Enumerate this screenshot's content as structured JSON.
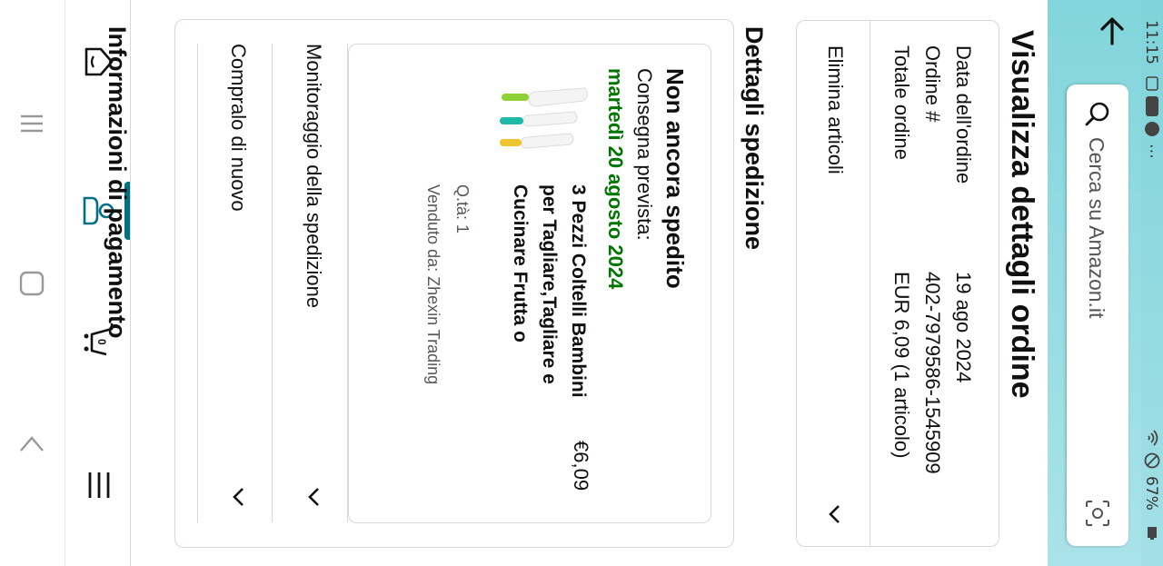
{
  "status_bar": {
    "time": "11:15",
    "battery": "67%"
  },
  "header": {
    "search_placeholder": "Cerca su Amazon.it"
  },
  "page": {
    "title": "Visualizza dettagli ordine"
  },
  "order_info": {
    "rows": [
      {
        "label": "Data dell'ordine",
        "value": "19 ago 2024"
      },
      {
        "label": "Ordine #",
        "value": "402-7979586-1545909"
      },
      {
        "label": "Totale ordine",
        "value": "EUR 6,09 (1 articolo)"
      }
    ],
    "delete_label": "Elimina articoli"
  },
  "shipment": {
    "heading": "Dettagli spedizione",
    "status": "Non ancora spedito",
    "eta_label": "Consegna prevista:",
    "eta_date": "martedì 20 agosto 2024",
    "item": {
      "title": "3 Pezzi Coltelli Bambini per Tagliare,Tagliare e Cucinare Frutta o",
      "price": "€6,09",
      "qty": "Q.tà: 1",
      "seller": "Venduto da: Zhexin Trading"
    },
    "actions": [
      {
        "label": "Monitoraggio della spedizione"
      },
      {
        "label": "Compralo di nuovo"
      }
    ]
  },
  "payment": {
    "heading": "Informazioni di pagamento"
  },
  "colors": {
    "header": "#8fdbe0",
    "accent": "#007185",
    "eta": "#007600"
  }
}
